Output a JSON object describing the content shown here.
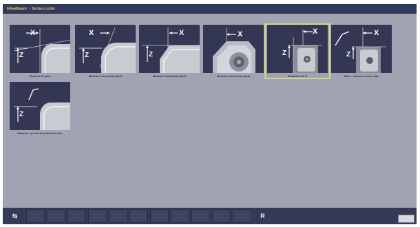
{
  "window": {
    "path_segment_1": "Infeedboard",
    "path_separator": "›",
    "path_segment_2": "Surface cutter"
  },
  "colors": {
    "title_text": "#e1dc5a",
    "selection": "#d3d781",
    "panel": "#343753",
    "background": "#a1a3b3"
  },
  "tiles": [
    {
      "label": "Measure Z value",
      "x_label": "X",
      "z_label": "Z",
      "icon": "measure-z-value-icon"
    },
    {
      "label": "Measure theoretical point",
      "x_label": "X",
      "z_label": "Z",
      "icon": "theoretical-point-icon"
    },
    {
      "label": "Measure theoretical point",
      "x_label": "X",
      "z_label": "Z",
      "icon": "theoretical-point-block-icon"
    },
    {
      "label": "Measure theoretical point",
      "x_label": "X",
      "z_label": "",
      "icon": "theoretical-point-spindle-icon"
    },
    {
      "label": "Measure Z & X",
      "x_label": "X",
      "z_label": "Z",
      "icon": "measure-z-x-icon",
      "selected": true
    },
    {
      "label": "Meas. / preset to max. dim.",
      "x_label": "X",
      "z_label": "Z",
      "icon": "preset-max-dim-icon"
    },
    {
      "label": "Measure / preset to maximum dim.",
      "x_label": "",
      "z_label": "Z",
      "icon": "preset-maximum-dim-icon"
    }
  ],
  "softkeys": {
    "left_symbol": "⇆",
    "right_symbol": "R"
  }
}
